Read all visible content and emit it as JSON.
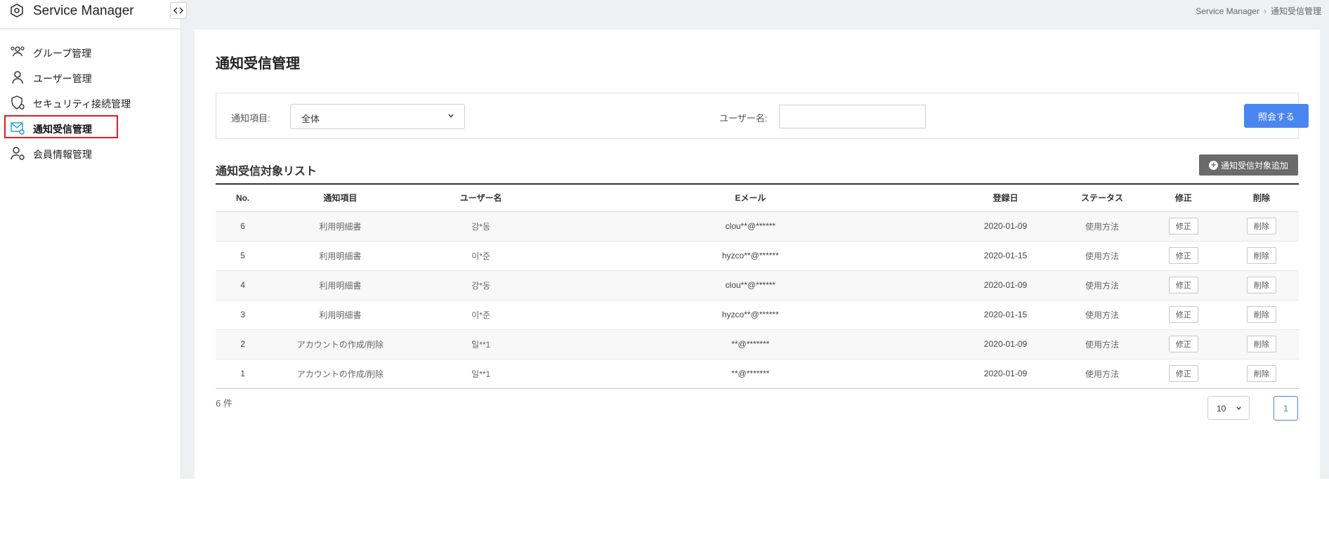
{
  "app": {
    "title": "Service Manager"
  },
  "breadcrumb": {
    "root": "Service Manager",
    "separator": "›",
    "current": "通知受信管理"
  },
  "sidebar": {
    "items": [
      {
        "label": "グループ管理",
        "icon": "group-icon"
      },
      {
        "label": "ユーザー管理",
        "icon": "user-icon"
      },
      {
        "label": "セキュリティ接続管理",
        "icon": "shield-gear-icon"
      },
      {
        "label": "通知受信管理",
        "icon": "mail-gear-icon",
        "active": true
      },
      {
        "label": "会員情報管理",
        "icon": "user-gear-icon"
      }
    ]
  },
  "main": {
    "page_title": "通知受信管理",
    "search": {
      "item_label": "通知項目:",
      "item_value": "全体",
      "username_label": "ユーザー名:",
      "username_value": "",
      "search_button": "照会する"
    },
    "list_title": "通知受信対象リスト",
    "add_button": "通知受信対象追加",
    "table": {
      "columns": [
        "No.",
        "通知項目",
        "ユーザー名",
        "Eメール",
        "登録日",
        "ステータス",
        "修正",
        "削除"
      ],
      "rows": [
        {
          "no": "6",
          "item": "利用明細書",
          "user": "강*동",
          "email": "clou**@******",
          "date": "2020-01-09",
          "status": "使用方法",
          "edit": "修正",
          "delete": "削除"
        },
        {
          "no": "5",
          "item": "利用明細書",
          "user": "이*준",
          "email": "hyzco**@******",
          "date": "2020-01-15",
          "status": "使用方法",
          "edit": "修正",
          "delete": "削除"
        },
        {
          "no": "4",
          "item": "利用明細書",
          "user": "강*동",
          "email": "clou**@******",
          "date": "2020-01-09",
          "status": "使用方法",
          "edit": "修正",
          "delete": "削除"
        },
        {
          "no": "3",
          "item": "利用明細書",
          "user": "이*준",
          "email": "hyzco**@******",
          "date": "2020-01-15",
          "status": "使用方法",
          "edit": "修正",
          "delete": "削除"
        },
        {
          "no": "2",
          "item": "アカウントの作成/削除",
          "user": "일**1",
          "email": "**@*******",
          "date": "2020-01-09",
          "status": "使用方法",
          "edit": "修正",
          "delete": "削除"
        },
        {
          "no": "1",
          "item": "アカウントの作成/削除",
          "user": "일**1",
          "email": "**@*******",
          "date": "2020-01-09",
          "status": "使用方法",
          "edit": "修正",
          "delete": "削除"
        }
      ]
    },
    "pagination": {
      "count": "6 件",
      "page_size": "10",
      "current_page": "1"
    }
  },
  "colors": {
    "primary": "#4a86f0",
    "active_highlight": "#e01b24",
    "add_button": "#6b6b6b",
    "background": "#eef0f3"
  }
}
